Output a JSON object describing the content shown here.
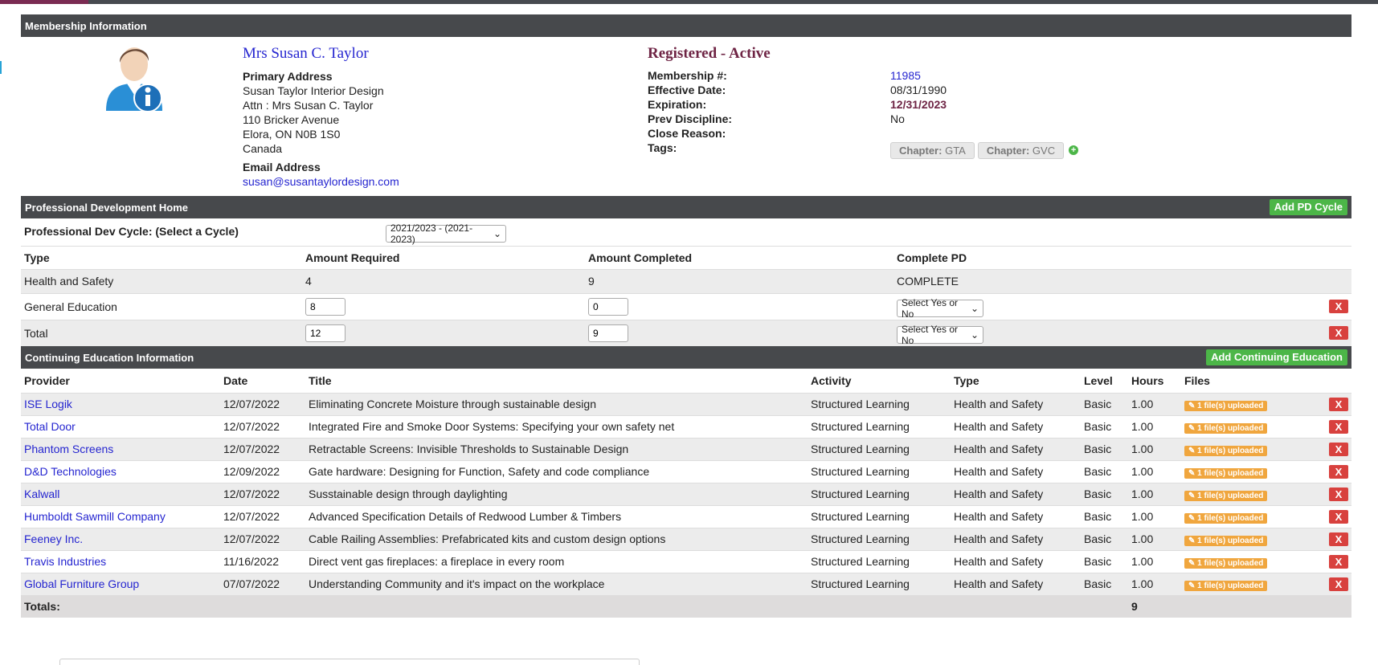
{
  "membership": {
    "section_title": "Membership Information",
    "name": "Mrs Susan C. Taylor",
    "primary_address_label": "Primary Address",
    "address_lines": [
      "Susan Taylor Interior Design",
      "Attn : Mrs Susan C. Taylor",
      "110 Bricker Avenue",
      "Elora, ON N0B 1S0",
      "Canada"
    ],
    "email_label": "Email Address",
    "email": "susan@susantaylordesign.com",
    "status": "Registered - Active",
    "fields": {
      "membership_no_label": "Membership #:",
      "membership_no": "11985",
      "effective_label": "Effective Date:",
      "effective": "08/31/1990",
      "expiration_label": "Expiration:",
      "expiration": "12/31/2023",
      "prev_label": "Prev Discipline:",
      "prev": "No",
      "close_label": "Close Reason:",
      "close": "",
      "tags_label": "Tags:"
    },
    "tags": [
      {
        "prefix": "Chapter:",
        "value": "GTA"
      },
      {
        "prefix": "Chapter:",
        "value": "GVC"
      }
    ],
    "tag_add_icon": "plus-circle-icon"
  },
  "pd": {
    "section_title": "Professional Development Home",
    "add_button": "Add PD Cycle",
    "cycle_label": "Professional Dev Cycle: (Select a Cycle)",
    "cycle_selected": "2021/2023 - (2021-2023)",
    "headers": [
      "Type",
      "Amount Required",
      "Amount Completed",
      "Complete PD"
    ],
    "rows": [
      {
        "type": "Health and Safety",
        "required": "4",
        "completed": "9",
        "complete": "COMPLETE"
      },
      {
        "type": "General Education",
        "required": "8",
        "completed": "0",
        "complete": "Select Yes or No"
      },
      {
        "type": "Total",
        "required": "12",
        "completed": "9",
        "complete": "Select Yes or No"
      }
    ],
    "delete_label": "X"
  },
  "ce": {
    "section_title": "Continuing Education Information",
    "add_button": "Add Continuing Education",
    "headers": [
      "Provider",
      "Date",
      "Title",
      "Activity",
      "Type",
      "Level",
      "Hours",
      "Files"
    ],
    "files_badge": "✎ 1 file(s) uploaded",
    "delete_label": "X",
    "rows": [
      {
        "provider": "ISE Logik",
        "date": "12/07/2022",
        "title": "Eliminating Concrete Moisture through sustainable design",
        "activity": "Structured Learning",
        "type": "Health and Safety",
        "level": "Basic",
        "hours": "1.00"
      },
      {
        "provider": "Total Door",
        "date": "12/07/2022",
        "title": "Integrated Fire and Smoke Door Systems: Specifying your own safety net",
        "activity": "Structured Learning",
        "type": "Health and Safety",
        "level": "Basic",
        "hours": "1.00"
      },
      {
        "provider": "Phantom Screens",
        "date": "12/07/2022",
        "title": "Retractable Screens: Invisible Thresholds to Sustainable Design",
        "activity": "Structured Learning",
        "type": "Health and Safety",
        "level": "Basic",
        "hours": "1.00"
      },
      {
        "provider": "D&D Technologies",
        "date": "12/09/2022",
        "title": "Gate hardware: Designing for Function, Safety and code compliance",
        "activity": "Structured Learning",
        "type": "Health and Safety",
        "level": "Basic",
        "hours": "1.00"
      },
      {
        "provider": "Kalwall",
        "date": "12/07/2022",
        "title": "Susstainable design through daylighting",
        "activity": "Structured Learning",
        "type": "Health and Safety",
        "level": "Basic",
        "hours": "1.00"
      },
      {
        "provider": "Humboldt Sawmill Company",
        "date": "12/07/2022",
        "title": "Advanced Specification Details of Redwood Lumber & Timbers",
        "activity": "Structured Learning",
        "type": "Health and Safety",
        "level": "Basic",
        "hours": "1.00"
      },
      {
        "provider": "Feeney Inc.",
        "date": "12/07/2022",
        "title": "Cable Railing Assemblies: Prefabricated kits and custom design options",
        "activity": "Structured Learning",
        "type": "Health and Safety",
        "level": "Basic",
        "hours": "1.00"
      },
      {
        "provider": "Travis Industries",
        "date": "11/16/2022",
        "title": "Direct vent gas fireplaces: a fireplace in every room",
        "activity": "Structured Learning",
        "type": "Health and Safety",
        "level": "Basic",
        "hours": "1.00"
      },
      {
        "provider": "Global Furniture Group",
        "date": "07/07/2022",
        "title": "Understanding Community and it's impact on the workplace",
        "activity": "Structured Learning",
        "type": "Health and Safety",
        "level": "Basic",
        "hours": "1.00"
      }
    ],
    "totals_label": "Totals:",
    "totals_hours": "9"
  },
  "colors": {
    "header_bg": "#47494c",
    "green": "#4cb648",
    "red": "#d8413e",
    "link": "#2525d0",
    "status": "#6e2444",
    "badge": "#f0a63e"
  }
}
